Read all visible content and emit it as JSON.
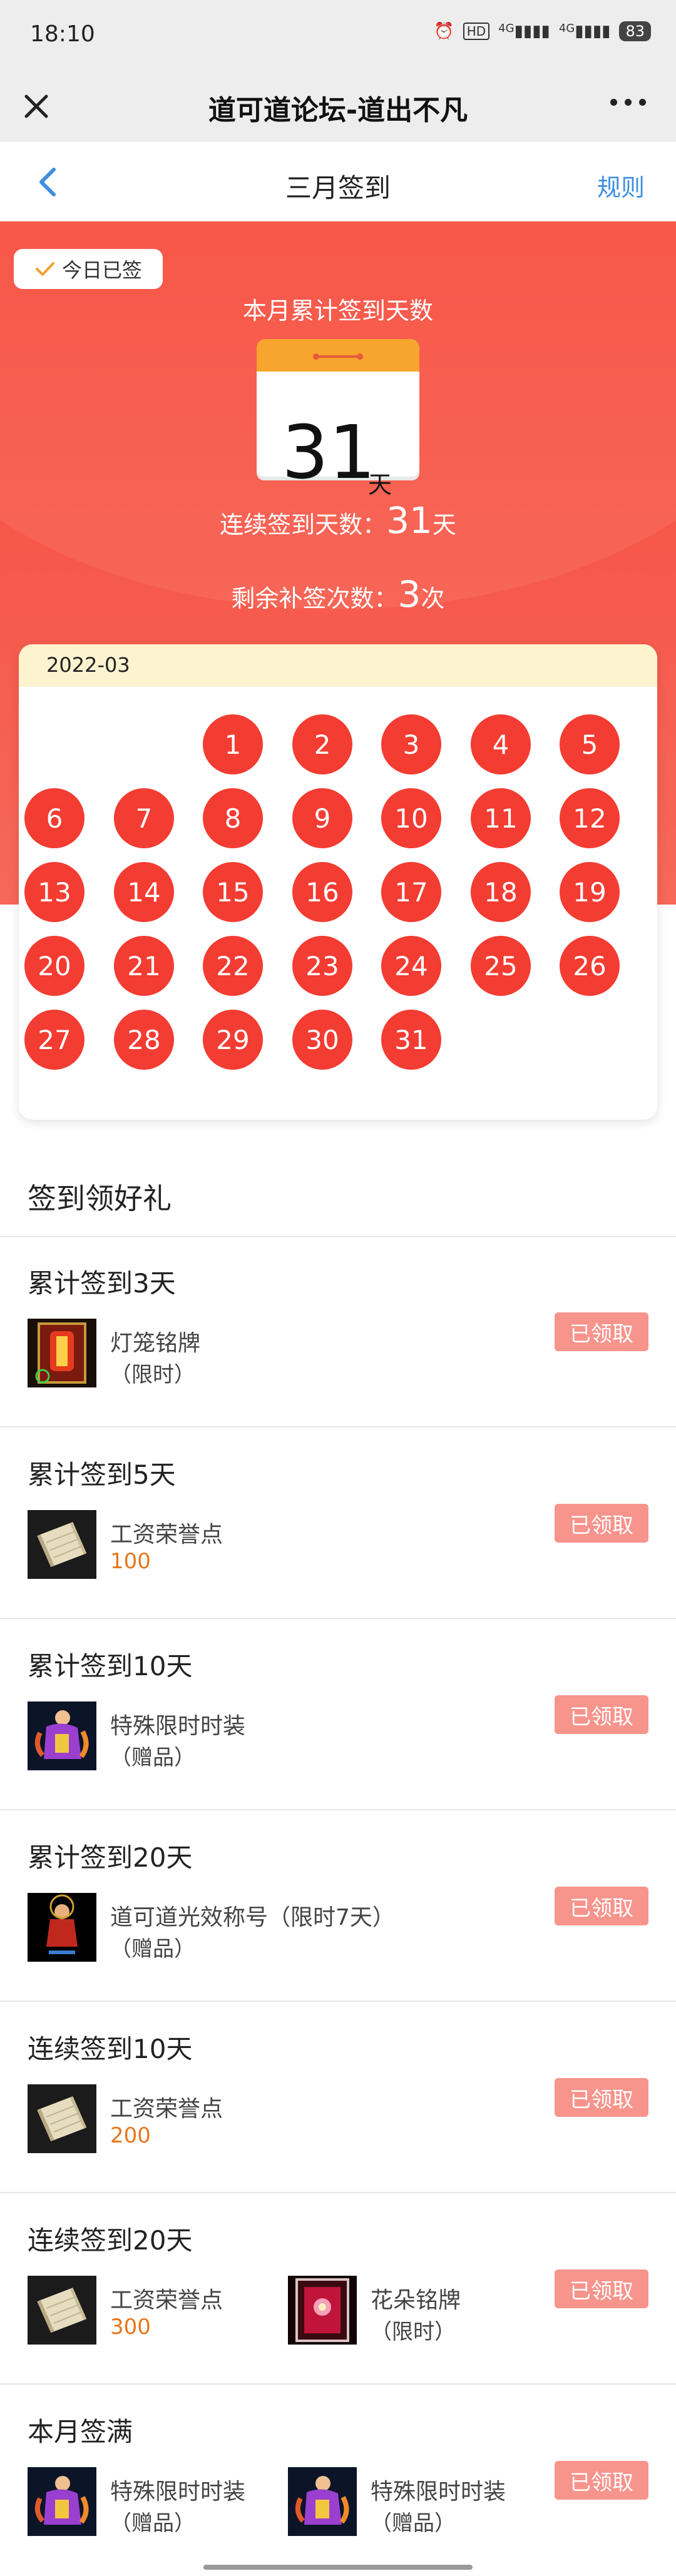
{
  "status": {
    "time": "18:10",
    "icons": [
      "alarm-icon",
      "hd-icon",
      "4g-signal-icon",
      "4g-signal-icon"
    ],
    "network1": "4G",
    "network2": "4G",
    "battery": "83"
  },
  "app": {
    "title": "道可道论坛-道出不凡"
  },
  "nav": {
    "title": "三月签到",
    "rules": "规则"
  },
  "hero": {
    "today_badge": "今日已签",
    "month_label": "本月累计签到天数",
    "month_days": "31",
    "day_unit": "天",
    "streak_label": "连续签到天数：",
    "streak_value": "31",
    "streak_unit": "天",
    "makeup_label": "剩余补签次数：",
    "makeup_value": "3",
    "makeup_unit": "次"
  },
  "calendar": {
    "month": "2022-03",
    "first_weekday": 2,
    "days": [
      "1",
      "2",
      "3",
      "4",
      "5",
      "6",
      "7",
      "8",
      "9",
      "10",
      "11",
      "12",
      "13",
      "14",
      "15",
      "16",
      "17",
      "18",
      "19",
      "20",
      "21",
      "22",
      "23",
      "24",
      "25",
      "26",
      "27",
      "28",
      "29",
      "30",
      "31"
    ],
    "signed_color": "#f33c32"
  },
  "rewards": {
    "section_title": "签到领好礼",
    "claimed_label": "已领取",
    "items": [
      {
        "title": "累计签到3天",
        "gifts": [
          {
            "name": "灯笼铭牌",
            "sub": "（限时）",
            "icon": "lantern-plaque-icon"
          }
        ]
      },
      {
        "title": "累计签到5天",
        "gifts": [
          {
            "name": "工资荣誉点",
            "sub": "100",
            "icon": "scroll-icon"
          }
        ]
      },
      {
        "title": "累计签到10天",
        "gifts": [
          {
            "name": "特殊限时时装",
            "sub": "（赠品）",
            "icon": "costume-icon"
          }
        ]
      },
      {
        "title": "累计签到20天",
        "gifts": [
          {
            "name": "道可道光效称号（限时7天）",
            "sub": "（赠品）",
            "icon": "title-effect-icon"
          }
        ]
      },
      {
        "title": "连续签到10天",
        "gifts": [
          {
            "name": "工资荣誉点",
            "sub": "200",
            "icon": "scroll-icon"
          }
        ]
      },
      {
        "title": "连续签到20天",
        "gifts": [
          {
            "name": "工资荣誉点",
            "sub": "300",
            "icon": "scroll-icon"
          },
          {
            "name": "花朵铭牌",
            "sub": "（限时）",
            "icon": "flower-plaque-icon"
          }
        ]
      },
      {
        "title": "本月签满",
        "gifts": [
          {
            "name": "特殊限时时装",
            "sub": "（赠品）",
            "icon": "costume-icon"
          },
          {
            "name": "特殊限时时装",
            "sub": "（赠品）",
            "icon": "costume-icon"
          }
        ]
      }
    ]
  },
  "colors": {
    "accent": "#f64a3c",
    "link": "#3d8fe0",
    "claimed_button": "#f7948c",
    "points_text": "#e8761c"
  }
}
